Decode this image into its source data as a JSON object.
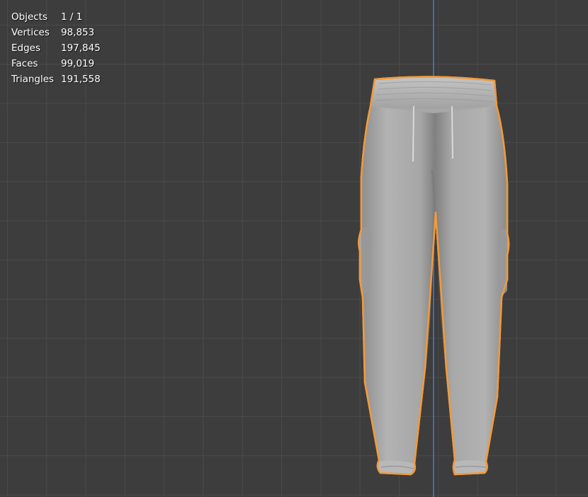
{
  "stats": {
    "rows": [
      {
        "label": "Objects",
        "value": "1 / 1"
      },
      {
        "label": "Vertices",
        "value": "98,853"
      },
      {
        "label": "Edges",
        "value": "197,845"
      },
      {
        "label": "Faces",
        "value": "99,019"
      },
      {
        "label": "Triangles",
        "value": "191,558"
      }
    ]
  },
  "colors": {
    "background": "#3d3d3d",
    "grid": "#4a4a4a",
    "z_axis": "#4a6aa8",
    "selection_outline": "#f29a3a",
    "mesh": "#a9a9a9"
  }
}
